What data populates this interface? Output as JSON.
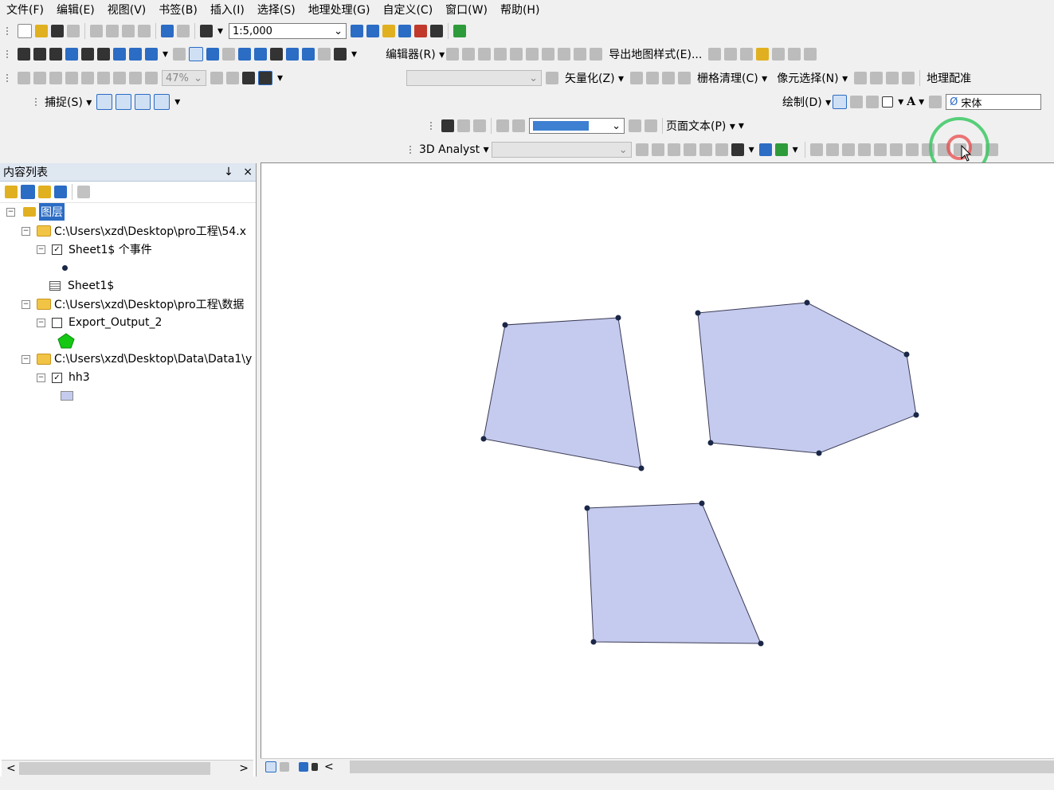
{
  "menu": [
    "文件(F)",
    "编辑(E)",
    "视图(V)",
    "书签(B)",
    "插入(I)",
    "选择(S)",
    "地理处理(G)",
    "自定义(C)",
    "窗口(W)",
    "帮助(H)"
  ],
  "toolbar": {
    "scale": "1:5,000",
    "editor": "编辑器(R)",
    "export_style": "导出地图样式(E)...",
    "zoom_pct": "47%",
    "vectorize": "矢量化(Z)",
    "raster_clean": "栅格清理(C)",
    "cell_select": "像元选择(N)",
    "georef": "地理配准",
    "snap": "捕捉(S)",
    "draw": "绘制(D)",
    "font": "宋体",
    "page_text": "页面文本(P)",
    "analyst_3d": "3D Analyst"
  },
  "toc": {
    "title": "内容列表",
    "pin": "↓",
    "close": "×",
    "layers_root": "图层",
    "group1_path": "C:\\Users\\xzd\\Desktop\\pro工程\\54.x",
    "layer1_name": "Sheet1$ 个事件",
    "table1_name": "Sheet1$",
    "group2_path": "C:\\Users\\xzd\\Desktop\\pro工程\\数据",
    "layer2_name": "Export_Output_2",
    "group3_path": "C:\\Users\\xzd\\Desktop\\Data\\Data1\\y",
    "layer3_name": "hh3"
  },
  "colors": {
    "polygon_fill": "#c5cbee",
    "vertex": "#1a2747",
    "pentagon_symbol": "#14c814",
    "highlight_ring": "#3cc864",
    "click_dot": "#e84a4a"
  }
}
